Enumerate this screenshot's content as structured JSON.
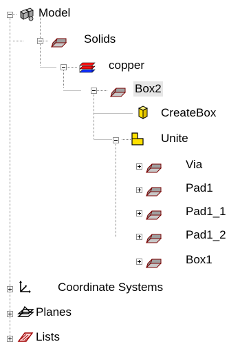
{
  "tree": {
    "model": {
      "label": "Model",
      "icon": "model-icon",
      "state": "expanded"
    },
    "solids": {
      "label": "Solids",
      "icon": "solid-box-icon",
      "state": "expanded"
    },
    "copper": {
      "label": "copper",
      "icon": "material-layers-icon",
      "state": "expanded"
    },
    "box2": {
      "label": "Box2",
      "icon": "solid-box-icon",
      "state": "expanded",
      "selected": true
    },
    "createbox": {
      "label": "CreateBox",
      "icon": "create-box-icon"
    },
    "unite": {
      "label": "Unite",
      "icon": "unite-icon",
      "state": "expanded"
    },
    "children": [
      {
        "label": "Via",
        "icon": "solid-box-icon",
        "state": "collapsed"
      },
      {
        "label": "Pad1",
        "icon": "solid-box-icon",
        "state": "collapsed"
      },
      {
        "label": "Pad1_1",
        "icon": "solid-box-icon",
        "state": "collapsed"
      },
      {
        "label": "Pad1_2",
        "icon": "solid-box-icon",
        "state": "collapsed"
      },
      {
        "label": "Box1",
        "icon": "solid-box-icon",
        "state": "collapsed"
      }
    ],
    "coordinate_systems": {
      "label": "Coordinate Systems",
      "icon": "coordinate-axes-icon",
      "state": "collapsed"
    },
    "planes": {
      "label": "Planes",
      "icon": "planes-icon",
      "state": "collapsed"
    },
    "lists": {
      "label": "Lists",
      "icon": "lists-icon",
      "state": "collapsed"
    }
  },
  "colors": {
    "box_fill": "#a0a0a0",
    "box_outline": "#7a0000",
    "copper_red": "#ff1010",
    "copper_blue": "#1030ff",
    "createbox_yellow": "#ffe000",
    "unite_yellow": "#ffe000",
    "selected_bg": "#e6e6e6",
    "connector": "#808080"
  }
}
